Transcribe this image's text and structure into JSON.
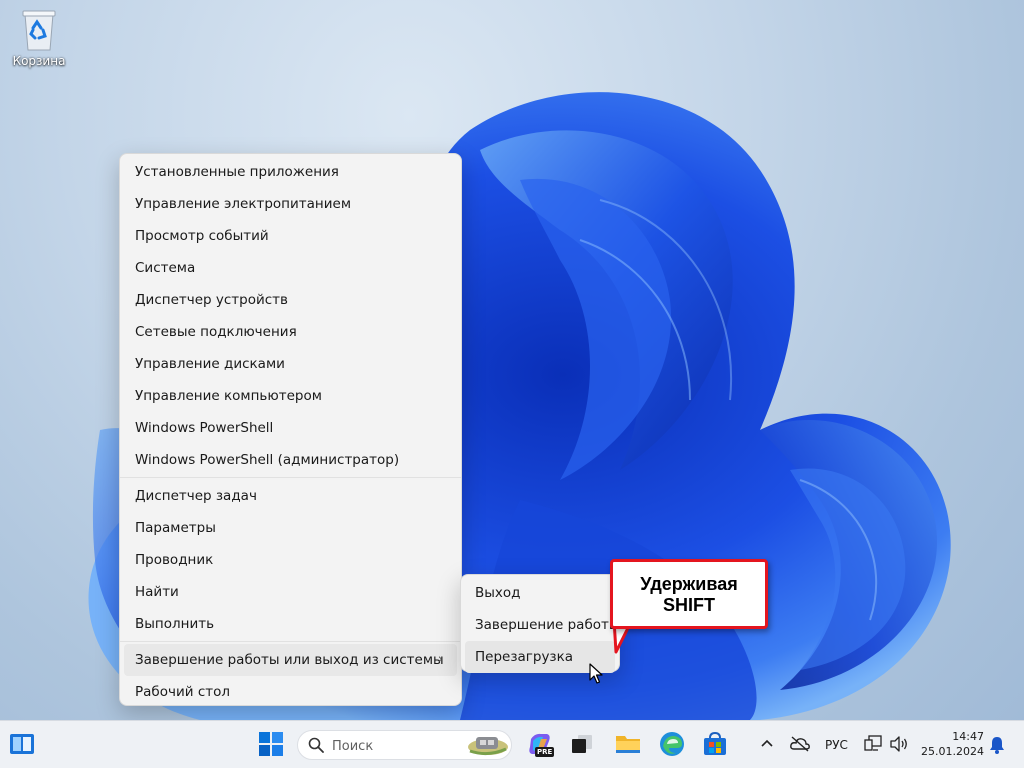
{
  "desktop": {
    "recycle_bin_label": "Корзина"
  },
  "context_menu": {
    "group1": [
      "Установленные приложения",
      "Управление электропитанием",
      "Просмотр событий",
      "Система",
      "Диспетчер устройств",
      "Сетевые подключения",
      "Управление дисками",
      "Управление компьютером",
      "Windows PowerShell",
      "Windows PowerShell (администратор)"
    ],
    "group2": [
      "Диспетчер задач",
      "Параметры",
      "Проводник",
      "Найти",
      "Выполнить"
    ],
    "shutdown_item": "Завершение работы или выход из системы",
    "desktop_item": "Рабочий стол"
  },
  "submenu": {
    "items": [
      "Выход",
      "Завершение работы",
      "Перезагрузка"
    ]
  },
  "callout": {
    "line1": "Удерживая",
    "line2": "SHIFT"
  },
  "taskbar": {
    "search_placeholder": "Поиск",
    "language": "РУС",
    "time": "14:47",
    "date": "25.01.2024",
    "copilot_badge": "PRE"
  },
  "colors": {
    "accent": "#0067c0",
    "callout_border": "#e4151f",
    "wallpaper_blue": "#1f4fe0"
  }
}
